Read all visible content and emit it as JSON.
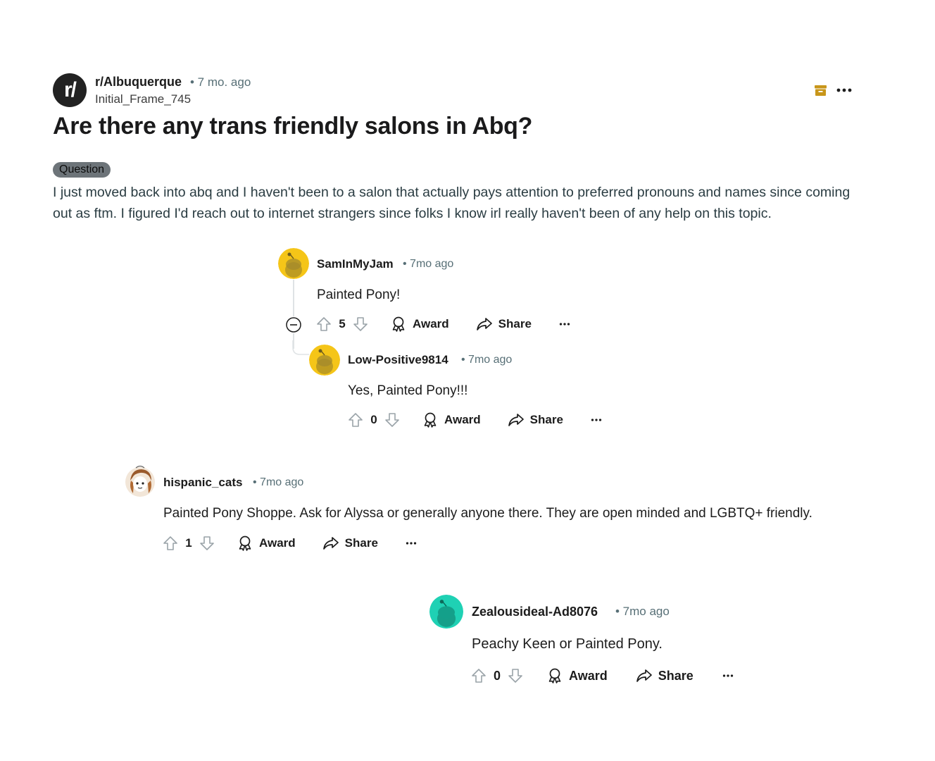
{
  "post": {
    "subreddit_logo": "r/",
    "subreddit": "r/Albuquerque",
    "age": "• 7 mo. ago",
    "author": "Initial_Frame_745",
    "title": "Are there any trans friendly salons in Abq?",
    "flair": "Question",
    "body": "I just moved back into abq and I haven't been to a salon that actually pays attention to preferred pronouns and names since coming out as ftm. I figured I'd reach out to internet strangers since folks I know irl really haven't been of any help on this topic.",
    "icons": {
      "archive": "archive-icon",
      "more": "more-options-icon"
    },
    "colors": {
      "archive": "#c8961a"
    }
  },
  "comments": [
    {
      "username": "SamInMyJam",
      "time": "• 7mo ago",
      "text": "Painted Pony!",
      "votes": "5",
      "award_label": "Award",
      "share_label": "Share",
      "avatar_color": "#f5c518"
    },
    {
      "username": "Low-Positive9814",
      "time": "• 7mo ago",
      "text": "Yes, Painted Pony!!!",
      "votes": "0",
      "award_label": "Award",
      "share_label": "Share",
      "avatar_color": "#f5c518"
    },
    {
      "username": "hispanic_cats",
      "time": "• 7mo ago",
      "text": "Painted Pony Shoppe. Ask for Alyssa or generally anyone there. They are open minded and LGBTQ+ friendly.",
      "votes": "1",
      "award_label": "Award",
      "share_label": "Share",
      "avatar_color": "#f2e6d8"
    },
    {
      "username": "Zealousideal-Ad8076",
      "time": "• 7mo ago",
      "text": "Peachy Keen or Painted Pony.",
      "votes": "0",
      "award_label": "Award",
      "share_label": "Share",
      "avatar_color": "#1fd1b4"
    }
  ]
}
